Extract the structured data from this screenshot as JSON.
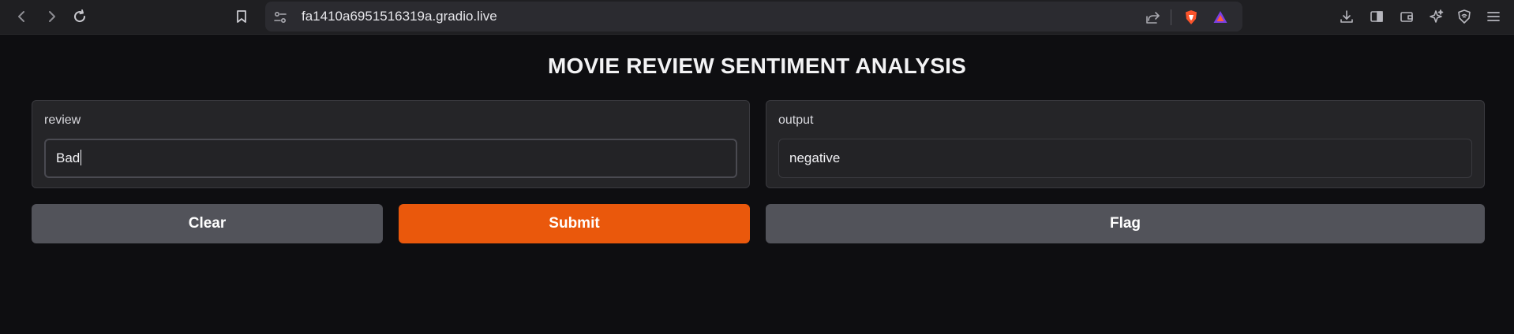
{
  "browser": {
    "url": "fa1410a6951516319a.gradio.live"
  },
  "app": {
    "title": "MOVIE REVIEW SENTIMENT ANALYSIS",
    "input_panel": {
      "label": "review",
      "value": "Bad"
    },
    "output_panel": {
      "label": "output",
      "value": "negative"
    },
    "buttons": {
      "clear": "Clear",
      "submit": "Submit",
      "flag": "Flag"
    }
  },
  "colors": {
    "background": "#0e0e11",
    "panel": "#252528",
    "primary_button": "#ea580c",
    "secondary_button": "#52535a"
  }
}
